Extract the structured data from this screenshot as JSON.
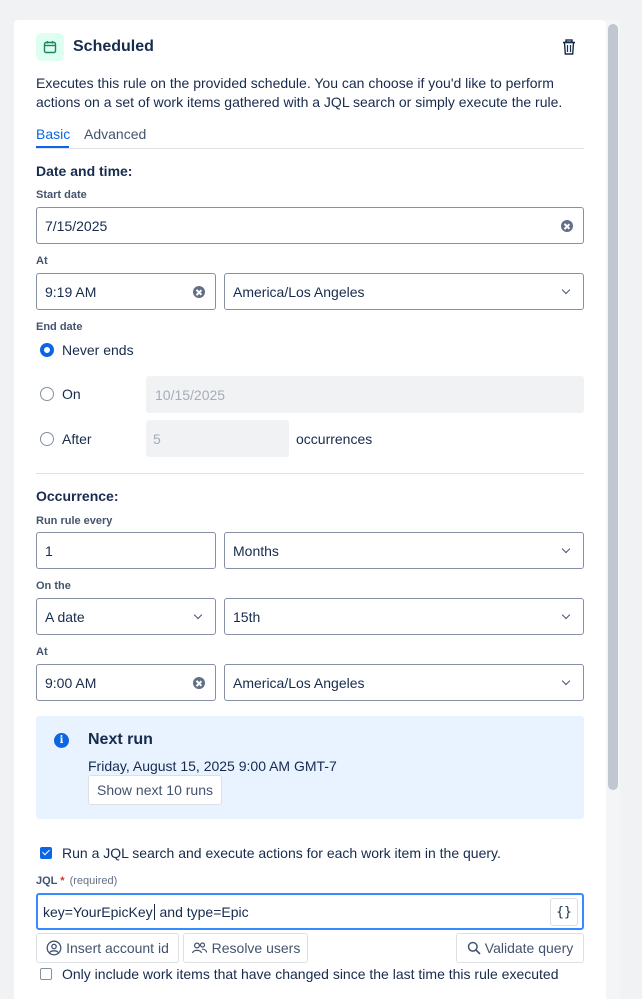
{
  "header": {
    "title": "Scheduled",
    "icon": "calendar-icon",
    "delete_icon": "trash-icon"
  },
  "description": "Executes this rule on the provided schedule. You can choose if you'd like to perform actions on a set of work items gathered with a JQL search or simply execute the rule.",
  "tabs": [
    {
      "label": "Basic",
      "active": true
    },
    {
      "label": "Advanced",
      "active": false
    }
  ],
  "date_time": {
    "section_title": "Date and time:",
    "start_date_label": "Start date",
    "start_date_value": "7/15/2025",
    "at_label": "At",
    "at_time": "9:19 AM",
    "timezone": "America/Los Angeles",
    "end_date_label": "End date",
    "end_options": {
      "never": "Never ends",
      "on": "On",
      "on_date_placeholder": "10/15/2025",
      "after": "After",
      "after_count_placeholder": "5",
      "occurrences_label": "occurrences",
      "selected": "never"
    }
  },
  "occurrence": {
    "section_title": "Occurrence:",
    "run_every_label": "Run rule every",
    "run_every_value": "1",
    "run_every_unit": "Months",
    "on_the_label": "On the",
    "on_the_type": "A date",
    "on_the_day": "15th",
    "at_label": "At",
    "at_time": "9:00 AM",
    "timezone": "America/Los Angeles"
  },
  "next_run": {
    "title": "Next run",
    "datetime": "Friday, August 15, 2025 9:00 AM GMT-7",
    "button": "Show next 10 runs"
  },
  "jql": {
    "run_search_label": "Run a JQL search and execute actions for each work item in the query.",
    "run_search_checked": true,
    "label": "JQL",
    "required_marker": "*",
    "required_text": "(required)",
    "value_before_caret": "key=YourEpicKey",
    "value_after_caret": " and type=Epic",
    "brace_button": "{}",
    "insert_account_button": "Insert account id",
    "resolve_users_button": "Resolve users",
    "validate_query_button": "Validate query",
    "only_changed_label": "Only include work items that have changed since the last time this rule executed",
    "only_changed_checked": false
  },
  "colors": {
    "accent": "#0c66e4",
    "info_bg": "#e9f2ff",
    "icon_bg": "#dcfff1",
    "icon_fg": "#1f845a"
  }
}
